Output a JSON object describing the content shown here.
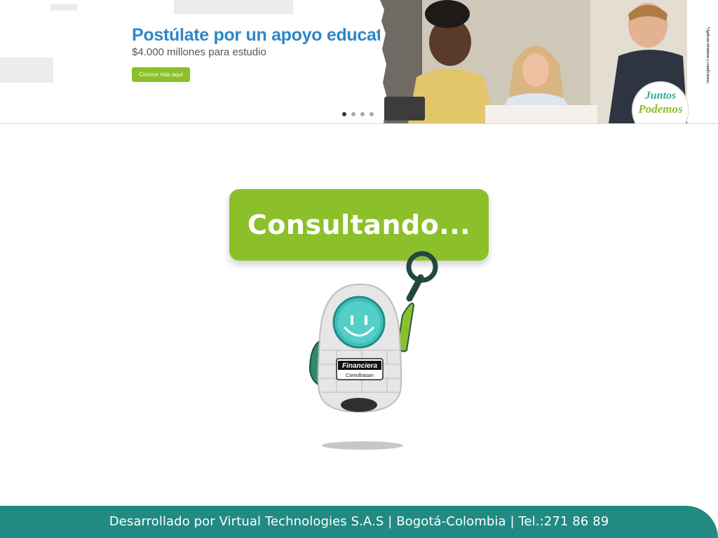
{
  "banner": {
    "title": "Postúlate por un apoyo educativo",
    "subtitle": "$4.000 millones para estudio",
    "cta_label": "Conoce más aquí",
    "legal_note": "*Aplican términos y condiciones.",
    "badge_line1": "Juntos",
    "badge_line2": "Podemos",
    "carousel": {
      "slides": 4,
      "active_index": 0
    }
  },
  "loading": {
    "text": "Consultando..."
  },
  "mascot": {
    "brand_line1": "Financiera",
    "brand_line2": "Comultrasan"
  },
  "footer": {
    "text": "Desarrollado por Virtual Technologies S.A.S  |  Bogotá-Colombia  |  Tel.:271 86 89"
  },
  "colors": {
    "accent_green": "#8cc02a",
    "footer_teal": "#218a82",
    "title_blue": "#2f86c6",
    "robot_screen": "#3fbfb8"
  }
}
